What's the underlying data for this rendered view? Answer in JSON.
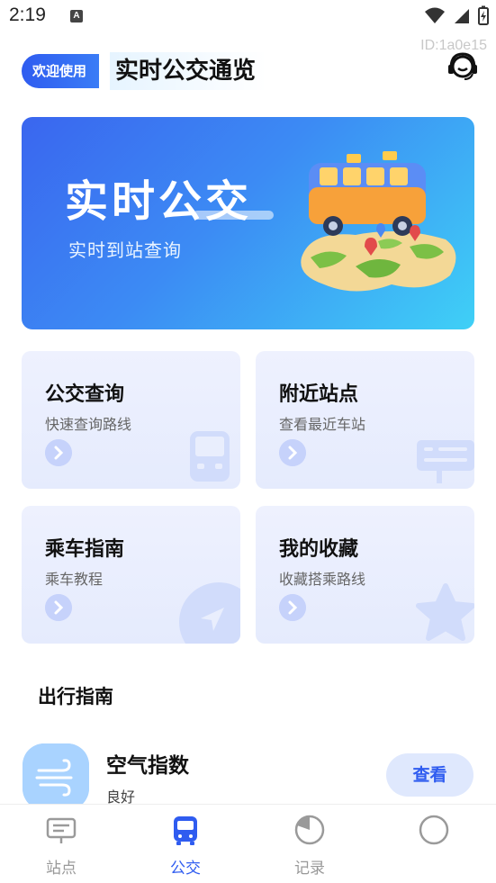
{
  "status_bar": {
    "time": "2:19",
    "notification_badge": "A",
    "icons": [
      "wifi-icon",
      "signal-icon",
      "battery-icon"
    ]
  },
  "device_id": "ID:1a0e15",
  "header": {
    "welcome": "欢迎使用",
    "title": "实时公交通览",
    "service_icon": "headset-icon"
  },
  "banner": {
    "title": "实时公交",
    "subtitle": "实时到站查询"
  },
  "cards": [
    {
      "title": "公交查询",
      "subtitle": "快速查询路线",
      "icon": "bus-icon"
    },
    {
      "title": "附近站点",
      "subtitle": "查看最近车站",
      "icon": "bus-stop-sign-icon"
    },
    {
      "title": "乘车指南",
      "subtitle": "乘车教程",
      "icon": "navigation-icon"
    },
    {
      "title": "我的收藏",
      "subtitle": "收藏搭乘路线",
      "icon": "star-icon"
    }
  ],
  "guide": {
    "section_title": "出行指南",
    "item": {
      "title": "空气指数",
      "status": "良好",
      "button": "查看",
      "icon": "wind-icon"
    }
  },
  "nav": {
    "items": [
      {
        "label": "站点",
        "icon": "station-board-icon",
        "active": false
      },
      {
        "label": "公交",
        "icon": "bus-icon",
        "active": true
      },
      {
        "label": "记录",
        "icon": "pie-record-icon",
        "active": false
      },
      {
        "label": "",
        "icon": "circle-icon",
        "active": false
      }
    ]
  },
  "colors": {
    "accent": "#2f5cf0",
    "banner_start": "#3a66ef",
    "banner_end": "#3fd0f6",
    "card_bg": "#eef1fe",
    "inactive": "#999999"
  }
}
